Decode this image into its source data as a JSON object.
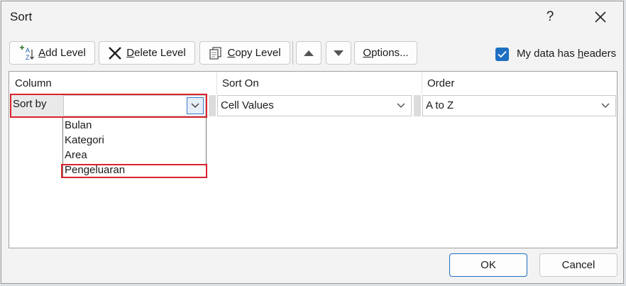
{
  "dialog": {
    "title": "Sort",
    "help_label": "?"
  },
  "toolbar": {
    "add_level": {
      "accel": "A",
      "rest": "dd Level"
    },
    "delete_level": {
      "accel": "D",
      "rest": "elete Level"
    },
    "copy_level": {
      "accel": "C",
      "rest": "opy Level"
    },
    "options": {
      "accel": "O",
      "rest": "ptions..."
    },
    "headers_checkbox": {
      "checked": true,
      "label_before": "My data has ",
      "accel": "h",
      "label_after": "eaders"
    }
  },
  "grid": {
    "headers": {
      "column": "Column",
      "sort_on": "Sort On",
      "order": "Order"
    },
    "row": {
      "label": "Sort by",
      "column_value": "",
      "sort_on_value": "Cell Values",
      "order_value": "A to Z"
    },
    "column_options": [
      "Bulan",
      "Kategori",
      "Area",
      "Pengeluaran"
    ]
  },
  "footer": {
    "ok": "OK",
    "cancel": "Cancel"
  },
  "colors": {
    "accent": "#1e6fc2",
    "highlight": "#d9232e"
  }
}
